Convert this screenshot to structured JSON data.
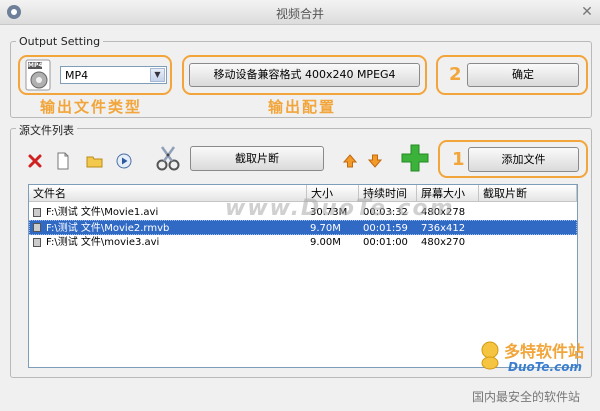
{
  "window": {
    "title": "视频合并"
  },
  "output_setting": {
    "group_label": "Output Setting",
    "format_value": "MP4",
    "format_badge": "MP4",
    "config_button_label": "移动设备兼容格式 400x240 MPEG4",
    "ok_button_label": "确定",
    "annotation_type": "输出文件类型",
    "annotation_config": "输出配置",
    "step2_number": "2"
  },
  "source_list": {
    "group_label": "源文件列表",
    "cut_button_label": "截取片断",
    "add_button_label": "添加文件",
    "step1_number": "1",
    "columns": [
      "文件名",
      "大小",
      "持续时间",
      "屏幕大小",
      "截取片断"
    ],
    "rows": [
      {
        "name": "F:\\测试 文件\\Movie1.avi",
        "size": "30.73M",
        "duration": "00:03:32",
        "screen": "480x278",
        "cut": "",
        "selected": false
      },
      {
        "name": "F:\\测试 文件\\Movie2.rmvb",
        "size": "9.70M",
        "duration": "00:01:59",
        "screen": "736x412",
        "cut": "",
        "selected": true
      },
      {
        "name": "F:\\测试 文件\\movie3.avi",
        "size": "9.00M",
        "duration": "00:01:00",
        "screen": "480x270",
        "cut": "",
        "selected": false
      }
    ]
  },
  "watermark": {
    "center": "www.DuoTe.com",
    "logo_text": "多特软件站",
    "logo_sub": "DuoTe.com",
    "footer": "国内最安全的软件站"
  },
  "colors": {
    "accent": "#f2a53a",
    "selection": "#316ac5",
    "add_icon": "#3bb33b",
    "delete_icon": "#d02020"
  }
}
